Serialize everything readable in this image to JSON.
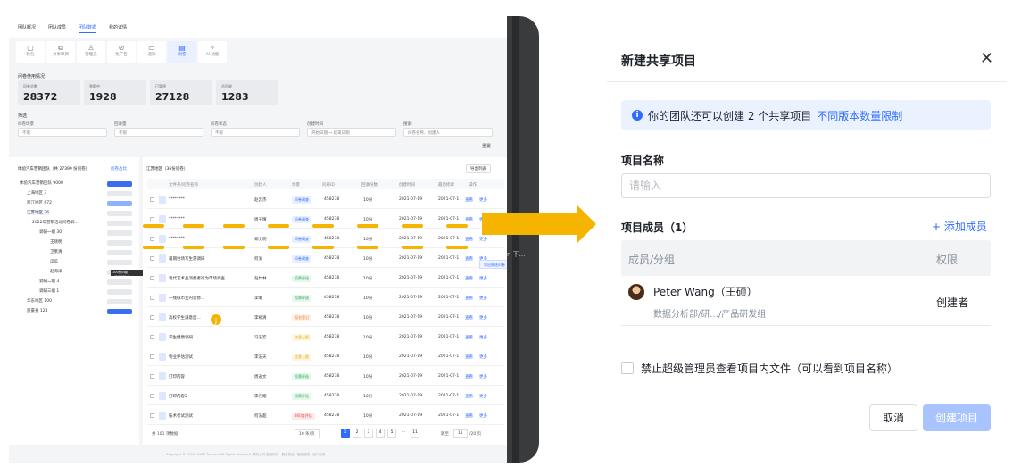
{
  "app": {
    "tabs": [
      "团队概况",
      "团队成员",
      "团队数据",
      "我的详情"
    ],
    "icon_tabs": [
      {
        "label": "秋包",
        "icon": "doc-icon"
      },
      {
        "label": "共享项目",
        "icon": "share-icon"
      },
      {
        "label": "管理员",
        "icon": "user-icon"
      },
      {
        "label": "免广告",
        "icon": "ad-icon"
      },
      {
        "label": "通知",
        "icon": "message-icon"
      },
      {
        "label": "问卷",
        "icon": "survey-icon"
      },
      {
        "label": "AI 功能",
        "icon": "sparkle-icon"
      }
    ],
    "usage_title": "问卷使用情况",
    "stats": [
      {
        "label": "问卷总数",
        "value": "28372"
      },
      {
        "label": "答题中",
        "value": "1928"
      },
      {
        "label": "已暂停",
        "value": "27128"
      },
      {
        "label": "总回收",
        "value": "1283"
      }
    ],
    "filter_title": "筛选",
    "filters": [
      {
        "label": "问卷场景",
        "value": "不限"
      },
      {
        "label": "回收量",
        "value": "不限"
      },
      {
        "label": "问卷状态",
        "value": "不限"
      },
      {
        "label": "创建时间",
        "value": "开始日期 → 结束日期"
      },
      {
        "label": "搜索:",
        "value": "问卷名称、创建人"
      }
    ],
    "reset": "重置",
    "tree_title": "体验汽车营销团队（共 27399 份问卷）",
    "tree_legend": "问卷占比",
    "tree": [
      "体验汽车营销团队 9000",
      "上海地区 3",
      "浙江地区 672",
      "江苏地区 36",
      "2022年营销活动问卷调...",
      "调研一组 30",
      "王晓明",
      "卫莱清",
      "瓜瓜",
      "赵海洋",
      "调研二组 3",
      "调研三组 1",
      "华东地区 100",
      "浙豪县 124"
    ],
    "tree_tooltip": "100份问卷（18.37%）",
    "table_title": "江苏地区（36份问卷）",
    "export": "导出列表",
    "columns": [
      "文件夹/问卷名称",
      "创建人",
      "场景",
      "问卷ID",
      "回收份数",
      "创建时间",
      "最后修改",
      "操作"
    ],
    "rows": [
      {
        "name": "********",
        "creator": "赵云杰",
        "scene": "问卷调查",
        "id": "458278",
        "count": "10份",
        "created": "2021-07-19",
        "modified": "2021-07-1"
      },
      {
        "name": "********",
        "creator": "周子晴",
        "scene": "问卷调查",
        "id": "458278",
        "count": "10份",
        "created": "2021-07-19",
        "modified": "2021-07-1"
      },
      {
        "name": "********",
        "creator": "郑文明",
        "scene": "问卷调查",
        "id": "458278",
        "count": "10份",
        "created": "2021-07-19",
        "modified": "2021-07-1"
      },
      {
        "name": "暑期驻场写生游调研",
        "creator": "何清",
        "scene": "问卷调查",
        "id": "458278",
        "count": "10份",
        "created": "2021-07-19",
        "modified": "2021-07-1"
      },
      {
        "name": "现代艺术品消费者行为市场调查...",
        "creator": "赵竹林",
        "scene": "投票评选",
        "id": "458278",
        "count": "10份",
        "created": "2021-07-19",
        "modified": "2021-07-1"
      },
      {
        "name": "一线城市室内装修...",
        "creator": "李明",
        "scene": "投票评选",
        "id": "458278",
        "count": "10份",
        "created": "2021-07-19",
        "modified": "2021-07-1"
      },
      {
        "name": "高校学生满意度...",
        "creator": "李树清",
        "scene": "报名登记",
        "id": "458278",
        "count": "10份",
        "created": "2021-07-19",
        "modified": "2021-07-1"
      },
      {
        "name": "学生健康调研",
        "creator": "冯浩宏",
        "scene": "信息上报",
        "id": "458278",
        "count": "10份",
        "created": "2021-07-19",
        "modified": "2021-07-1"
      },
      {
        "name": "物业评估测试",
        "creator": "李浩天",
        "scene": "信息上报",
        "id": "458278",
        "count": "10份",
        "created": "2021-07-19",
        "modified": "2021-07-1"
      },
      {
        "name": "打印内容",
        "creator": "周通文",
        "scene": "投票评选",
        "id": "458278",
        "count": "10份",
        "created": "2021-07-19",
        "modified": "2021-07-1"
      },
      {
        "name": "打印内容2",
        "creator": "李光耀",
        "scene": "投票评选",
        "id": "458278",
        "count": "10份",
        "created": "2021-07-19",
        "modified": "2021-07-1"
      },
      {
        "name": "技术考试测试",
        "creator": "何浩超",
        "scene": "360度评估",
        "id": "458278",
        "count": "10份",
        "created": "2021-07-19",
        "modified": "2021-07-1"
      }
    ],
    "row_actions": [
      "查看",
      "更多"
    ],
    "total": "共 101 项数据",
    "page_size": "10 条/页",
    "pages": [
      "1",
      "2",
      "3",
      "4",
      "5",
      "...",
      "11"
    ],
    "goto_label": "跳至",
    "goto_value": "11",
    "goto_suffix": "/20 页",
    "footer": "Copyright © 1998 - 2023 Tencent. All Rights Reserved. 腾讯公司 版权所有 · 服务协议 · 隐私政策 · 用户反馈",
    "side_tip": "导出筛选问卷（3份）",
    "side_text": "n 下...",
    "cursor_badge": "J"
  },
  "dialog": {
    "title": "新建共享项目",
    "info_text": "你的团队还可以创建 2 个共享项目",
    "info_link": "不同版本数量限制",
    "name_label": "项目名称",
    "name_placeholder": "请输入",
    "members_label": "项目成员（1）",
    "add_member": "+ 添加成员",
    "col_member": "成员/分组",
    "col_role": "权限",
    "member": {
      "name": "Peter Wang（王硕）",
      "dept": "数据分析部/研.../产品研发组",
      "role": "创建者"
    },
    "checkbox_label": "禁止超级管理员查看项目内文件（可以看到项目名称）",
    "cancel": "取消",
    "create": "创建项目"
  },
  "colors": {
    "accent": "#2f6bff",
    "highlight": "#f5b400",
    "dark_panel": "#3a3b3d"
  }
}
